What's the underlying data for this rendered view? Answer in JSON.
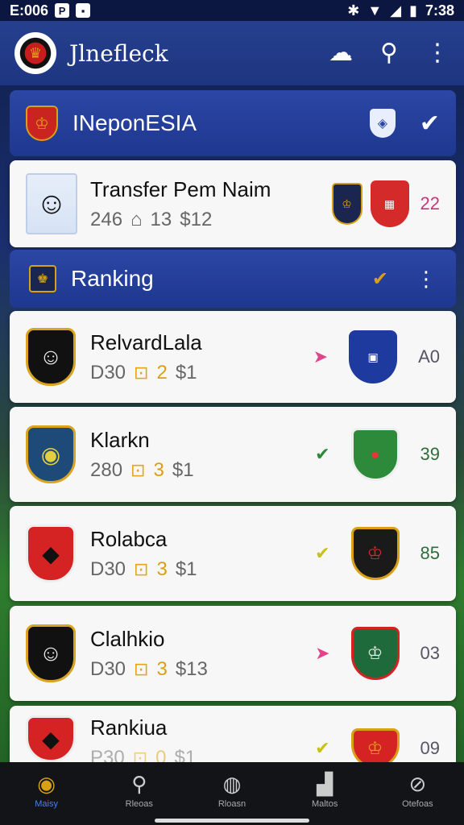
{
  "status_bar": {
    "time_left": "E:006",
    "time_right": "7:38"
  },
  "app_bar": {
    "title": "Jlnefleck"
  },
  "league_header": {
    "title": "INeponESIA"
  },
  "transfer_card": {
    "title": "Transfer Pem Naim",
    "stat_a": "246",
    "stat_b": "13",
    "stat_c": "$12",
    "count": "22"
  },
  "ranking_header": {
    "title": "Ranking"
  },
  "rows": [
    {
      "name": "RelvardLala",
      "code": "D30",
      "level": "2",
      "price": "$1",
      "value": "A0",
      "arrow_color": "#e0458c",
      "value_color": "#556"
    },
    {
      "name": "Klarkn",
      "code": "280",
      "level": "3",
      "price": "$1",
      "value": "39",
      "arrow_color": "#2d8a3a",
      "value_color": "#2d6e3a"
    },
    {
      "name": "Rolabca",
      "code": "D30",
      "level": "3",
      "price": "$1",
      "value": "85",
      "arrow_color": "#c9c11a",
      "value_color": "#2d6e3a"
    },
    {
      "name": "Clalhkio",
      "code": "D30",
      "level": "3",
      "price": "$13",
      "value": "03",
      "arrow_color": "#e0458c",
      "value_color": "#556"
    },
    {
      "name": "Rankiua",
      "code": "P30",
      "level": "0",
      "price": "$1",
      "value": "09",
      "arrow_color": "#c9c11a",
      "value_color": "#556"
    }
  ],
  "bottom_nav": [
    {
      "label": "Maisy",
      "icon": "home-icon"
    },
    {
      "label": "Rleoas",
      "icon": "search-icon"
    },
    {
      "label": "Rloasn",
      "icon": "ball-icon"
    },
    {
      "label": "Maltos",
      "icon": "stats-icon"
    },
    {
      "label": "Otefoas",
      "icon": "compass-icon"
    }
  ],
  "colors": {
    "app_bar": "#1e3580",
    "accent_gold": "#d9a015",
    "nav_active": "#4a7ff0"
  }
}
